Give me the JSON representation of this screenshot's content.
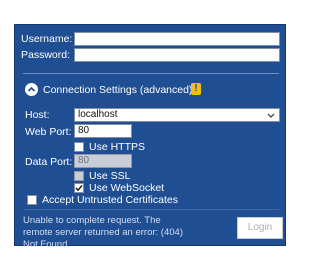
{
  "credentials": {
    "username_label": "Username:",
    "username_value": "",
    "password_label": "Password:",
    "password_value": ""
  },
  "connection": {
    "section_label": "Connection Settings (advanced)",
    "warning_icon": "warning-icon",
    "host_label": "Host:",
    "host_value": "localhost",
    "web_port_label": "Web Port:",
    "web_port_value": "80",
    "use_https_label": "Use HTTPS",
    "use_https_checked": false,
    "data_port_label": "Data Port:",
    "data_port_value": "80",
    "use_ssl_label": "Use SSL",
    "use_ssl_checked": false,
    "use_websocket_label": "Use WebSocket",
    "use_websocket_checked": true,
    "accept_untrusted_label": "Accept Untrusted Certificates",
    "accept_untrusted_checked": false
  },
  "status": {
    "message": "Unable to complete request. The remote server returned an error: (404) Not Found."
  },
  "actions": {
    "login_label": "Login"
  },
  "colors": {
    "panel": "#1f4e93",
    "warning": "#f2c200"
  }
}
